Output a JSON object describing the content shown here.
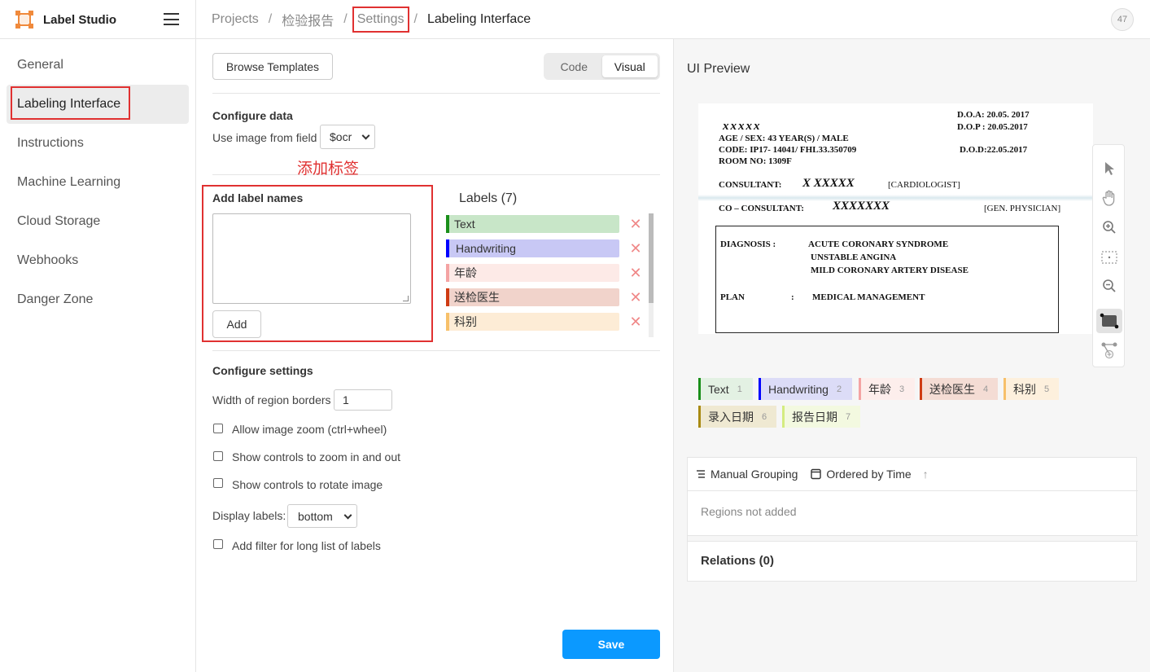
{
  "app": {
    "name": "Label Studio",
    "avatar": "47"
  },
  "breadcrumb": [
    "Projects",
    "检验报告",
    "Settings",
    "Labeling Interface"
  ],
  "sidebar": {
    "items": [
      {
        "label": "General"
      },
      {
        "label": "Labeling Interface"
      },
      {
        "label": "Instructions"
      },
      {
        "label": "Machine Learning"
      },
      {
        "label": "Cloud Storage"
      },
      {
        "label": "Webhooks"
      },
      {
        "label": "Danger Zone"
      }
    ],
    "active": "Labeling Interface"
  },
  "config": {
    "browse_templates": "Browse Templates",
    "mode_tabs": [
      "Code",
      "Visual"
    ],
    "active_mode": "Visual",
    "configure_data": "Configure data",
    "use_image_from_field": "Use image from field",
    "image_field": "$ocr",
    "annotation_note": "添加标签",
    "add_label_names": "Add label names",
    "add_button": "Add",
    "labels_title": "Labels (7)",
    "labels": [
      {
        "name": "Text",
        "color": "#1a8f1a",
        "bg": "#c8e6c8"
      },
      {
        "name": "Handwriting",
        "color": "#0000ff",
        "bg": "#c8c8f5"
      },
      {
        "name": "年龄",
        "color": "#f4a3a3",
        "bg": "#fdeae7"
      },
      {
        "name": "送检医生",
        "color": "#cf3b13",
        "bg": "#f1d3cb"
      },
      {
        "name": "科别",
        "color": "#f7c06a",
        "bg": "#fdecd6"
      }
    ],
    "configure_settings": "Configure settings",
    "region_border_label": "Width of region borders",
    "region_border_value": "1",
    "checkboxes": [
      "Allow image zoom (ctrl+wheel)",
      "Show controls to zoom in and out",
      "Show controls to rotate image"
    ],
    "display_labels_label": "Display labels:",
    "display_labels_value": "bottom",
    "filter_checkbox": "Add filter for long list of labels",
    "save": "Save"
  },
  "preview": {
    "title": "UI Preview",
    "document_lines": {
      "name": "xxxxx",
      "doa": "D.O.A: 20.05. 2017",
      "dop": "D.O.P : 20.05.2017",
      "age": "AGE / SEX: 43 YEAR(S) / MALE",
      "code": "CODE: IP17- 14041/ FHL33.350709",
      "dod": "D.O.D:22.05.2017",
      "room": "ROOM NO: 1309F",
      "consultant": "CONSULTANT:",
      "consultant_name": "X XXXXX",
      "cardiologist": "[CARDIOLOGIST]",
      "co_consultant": "CO – CONSULTANT:",
      "co_name": "XXXXXXX",
      "gen_physician": "[GEN. PHYSICIAN]",
      "diagnosis": "DIAGNOSIS :",
      "diag1": "ACUTE CORONARY SYNDROME",
      "diag2": "UNSTABLE ANGINA",
      "diag3": "MILD CORONARY ARTERY DISEASE",
      "plan": "PLAN",
      "plan_colon": ":",
      "plan_value": "MEDICAL MANAGEMENT"
    },
    "labels": [
      {
        "name": "Text",
        "hotkey": "1",
        "color": "#1a8f1a",
        "bg": "#e3f1e3"
      },
      {
        "name": "Handwriting",
        "hotkey": "2",
        "color": "#0000ff",
        "bg": "#dcdcf7"
      },
      {
        "name": "年龄",
        "hotkey": "3",
        "color": "#f4a3a3",
        "bg": "#fdeeec"
      },
      {
        "name": "送检医生",
        "hotkey": "4",
        "color": "#cf3b13",
        "bg": "#f4dcd4"
      },
      {
        "name": "科别",
        "hotkey": "5",
        "color": "#f7c06a",
        "bg": "#fdf0dd"
      },
      {
        "name": "录入日期",
        "hotkey": "6",
        "color": "#a88a12",
        "bg": "#efe9d2"
      },
      {
        "name": "报告日期",
        "hotkey": "7",
        "color": "#d4ec80",
        "bg": "#f3f9e0"
      }
    ],
    "grouping": "Manual Grouping",
    "ordering": "Ordered by Time",
    "regions_empty": "Regions not added",
    "relations": "Relations (0)"
  }
}
